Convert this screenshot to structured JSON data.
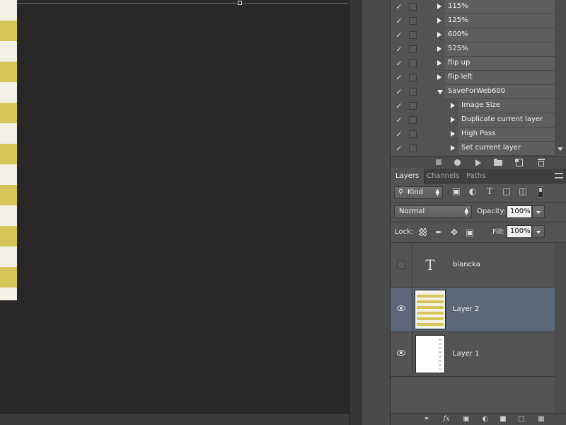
{
  "actions": {
    "items": [
      {
        "label": "115%",
        "checked": true,
        "expanded": false,
        "indent": 0
      },
      {
        "label": "125%",
        "checked": true,
        "expanded": false,
        "indent": 0
      },
      {
        "label": "600%",
        "checked": true,
        "expanded": false,
        "indent": 0
      },
      {
        "label": "525%",
        "checked": true,
        "expanded": false,
        "indent": 0
      },
      {
        "label": "flip up",
        "checked": true,
        "expanded": false,
        "indent": 0
      },
      {
        "label": "flip left",
        "checked": true,
        "expanded": false,
        "indent": 0
      },
      {
        "label": "SaveForWeb600",
        "checked": true,
        "expanded": true,
        "indent": 0
      },
      {
        "label": "Image Size",
        "checked": true,
        "expanded": false,
        "indent": 1
      },
      {
        "label": "Duplicate current layer",
        "checked": true,
        "expanded": false,
        "indent": 1
      },
      {
        "label": "High Pass",
        "checked": true,
        "expanded": false,
        "indent": 1
      },
      {
        "label": "Set current layer",
        "checked": true,
        "expanded": false,
        "indent": 1
      }
    ],
    "toolbar": [
      "stop-icon",
      "record-icon",
      "play-icon",
      "folder-icon",
      "new-action-icon",
      "trash-icon"
    ]
  },
  "layers_panel": {
    "tabs": [
      {
        "label": "Layers",
        "active": true
      },
      {
        "label": "Channels",
        "active": false
      },
      {
        "label": "Paths",
        "active": false
      }
    ],
    "filter": {
      "kind": "Kind"
    },
    "blend_mode": "Normal",
    "opacity_label": "Opacity:",
    "opacity_value": "100%",
    "lock_label": "Lock:",
    "fill_label": "Fill:",
    "fill_value": "100%",
    "layers": [
      {
        "name": "biancka",
        "type": "text",
        "visible": false,
        "selected": false
      },
      {
        "name": "Layer 2",
        "type": "stripes",
        "visible": true,
        "selected": true
      },
      {
        "name": "Layer 1",
        "type": "white",
        "visible": true,
        "selected": false
      }
    ]
  },
  "colors": {
    "selected_row": "#5b6777",
    "stripe_yellow": "#d6c659",
    "stripe_cream": "#f3f0e6",
    "canvas_bg": "#282828",
    "panel_bg": "#535353"
  }
}
